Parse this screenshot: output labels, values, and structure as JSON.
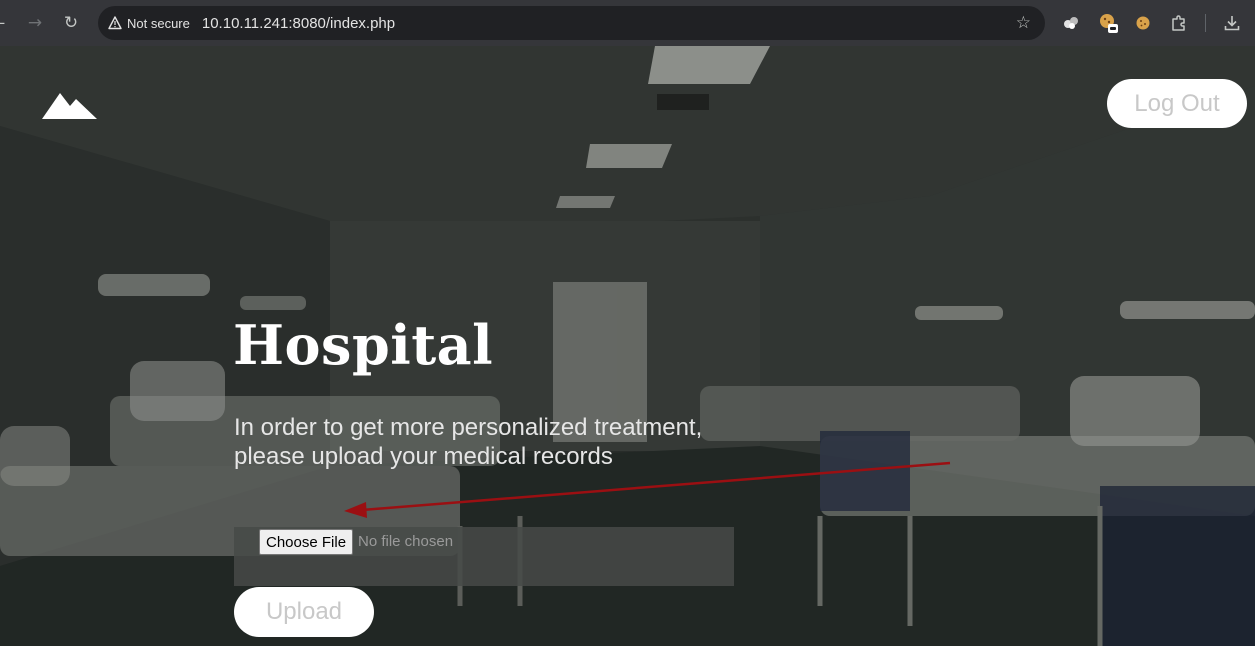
{
  "browser": {
    "security_label": "Not secure",
    "url": "10.10.11.241:8080/index.php",
    "icons": {
      "back": "back-arrow-icon",
      "forward": "forward-arrow-icon",
      "reload": "reload-icon",
      "warning": "warning-triangle-icon",
      "bookmark": "star-icon",
      "extensions": [
        "extension-icon",
        "cookie-extension-icon",
        "cookie-icon",
        "puzzle-icon"
      ],
      "download": "download-icon"
    }
  },
  "header": {
    "logo": "mountain-logo-icon",
    "logout_label": "Log Out"
  },
  "hero": {
    "title": "Hospital",
    "subtitle_line1": "In order to get more personalized treatment,",
    "subtitle_line2": "please upload your medical records"
  },
  "upload_form": {
    "choose_file_label": "Choose File",
    "file_status": "No file chosen",
    "upload_label": "Upload"
  },
  "colors": {
    "button_bg": "#ffffff",
    "button_text": "#c8c8c8",
    "annotation_arrow": "#9b0f12"
  }
}
